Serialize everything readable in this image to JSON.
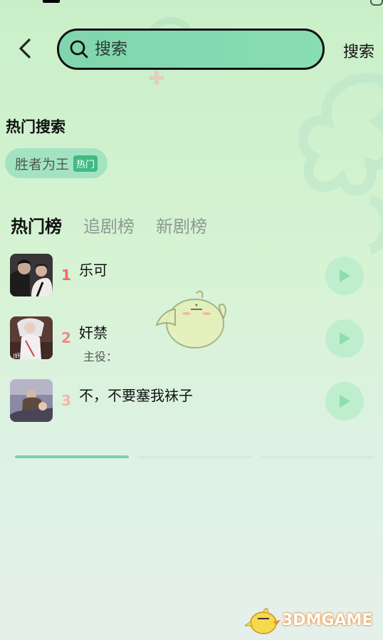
{
  "search": {
    "placeholder": "搜索",
    "submit_label": "搜索"
  },
  "hot_search": {
    "title": "热门搜索",
    "items": [
      {
        "label": "胜者为王",
        "badge": "热门"
      }
    ]
  },
  "tabs": [
    {
      "label": "热门榜",
      "active": true
    },
    {
      "label": "追剧榜",
      "active": false
    },
    {
      "label": "新剧榜",
      "active": false
    }
  ],
  "rank_list": [
    {
      "rank": "1",
      "title": "乐可",
      "subtitle": "",
      "rank_color": "#f06a6a"
    },
    {
      "rank": "2",
      "title": "奸禁",
      "subtitle": "主役：",
      "rank_color": "#f08a8a"
    },
    {
      "rank": "3",
      "title": "不，不要塞我袜子",
      "subtitle": "",
      "rank_color": "#f6b3ab"
    }
  ],
  "pager": {
    "pages": 3,
    "active": 0
  },
  "watermark": {
    "text": "3DMGAME"
  },
  "colors": {
    "accent": "#41b983",
    "search_fill": "#85dbb0",
    "play_button": "#bfeecf"
  }
}
